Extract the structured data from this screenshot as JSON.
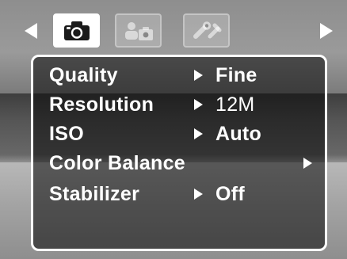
{
  "nav": {
    "left_arrow_icon": "triangle-left-icon",
    "right_arrow_icon": "triangle-right-icon",
    "tabs": [
      {
        "icon": "camera-icon",
        "active": true
      },
      {
        "icon": "scene-person-camera-icon",
        "active": false
      },
      {
        "icon": "setup-tools-icon",
        "active": false
      }
    ]
  },
  "menu": {
    "items": [
      {
        "label": "Quality",
        "value": "Fine"
      },
      {
        "label": "Resolution",
        "value": "12M"
      },
      {
        "label": "ISO",
        "value": "Auto"
      },
      {
        "label": "Color Balance",
        "value": ""
      },
      {
        "label": "Stabilizer",
        "value": "Off"
      }
    ]
  },
  "colors": {
    "text": "#ffffff",
    "panel_border": "#ffffff",
    "active_tab_bg": "#ffffff",
    "icon_dark": "#1a1a1a"
  }
}
